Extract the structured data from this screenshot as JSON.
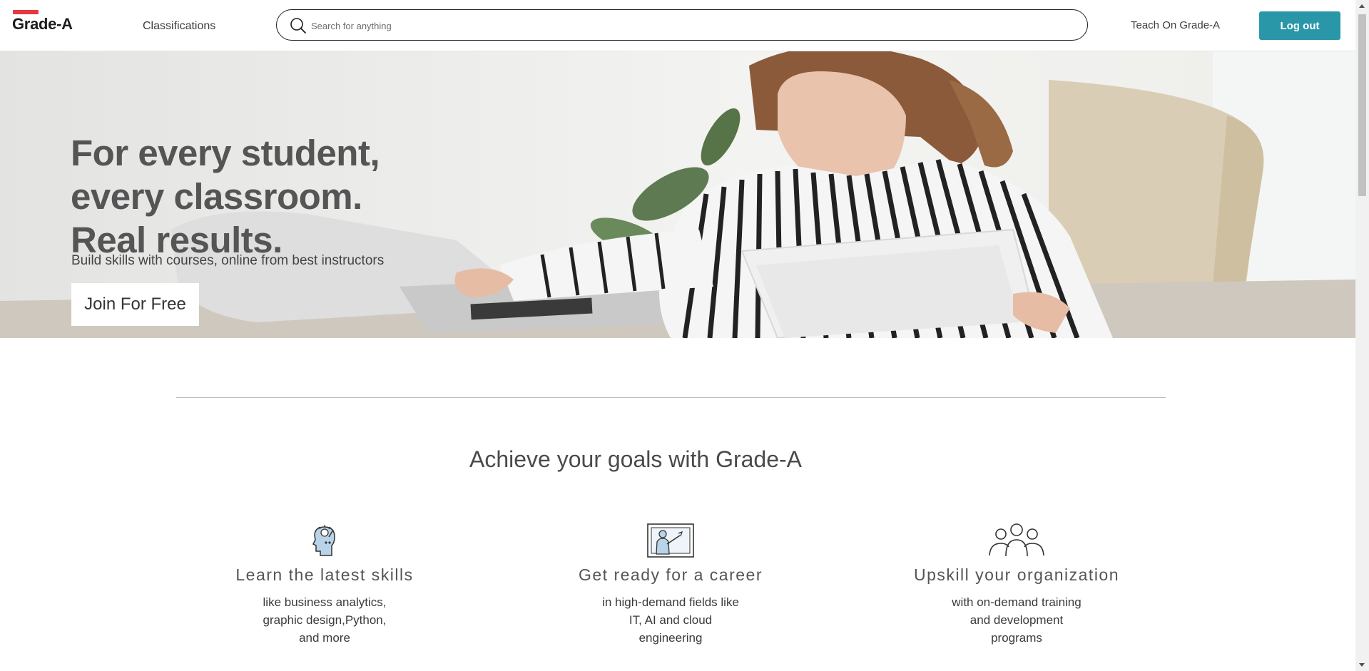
{
  "header": {
    "logo": "Grade-A",
    "classifications": "Classifications",
    "search_placeholder": "Search for anything",
    "teach": "Teach On Grade-A",
    "logout": "Log out"
  },
  "hero": {
    "title_lines": [
      "For every student,",
      "every classroom.",
      "Real results."
    ],
    "subtitle": "Build skills with courses, online from best instructors",
    "cta": "Join For Free"
  },
  "goals": {
    "title": "Achieve your goals with Grade-A",
    "features": [
      {
        "icon": "head-lightbulb-icon",
        "title": "Learn the latest skills",
        "description": "like business analytics, graphic design,Python, and more"
      },
      {
        "icon": "teacher-board-icon",
        "title": "Get ready for a career",
        "description": "in high-demand fields like IT, AI and cloud engineering"
      },
      {
        "icon": "group-people-icon",
        "title": "Upskill your organization",
        "description": "with on-demand training and development programs"
      }
    ]
  },
  "colors": {
    "accent": "#2a97a8",
    "logo_bar": "#e5393f",
    "text": "#555555"
  }
}
